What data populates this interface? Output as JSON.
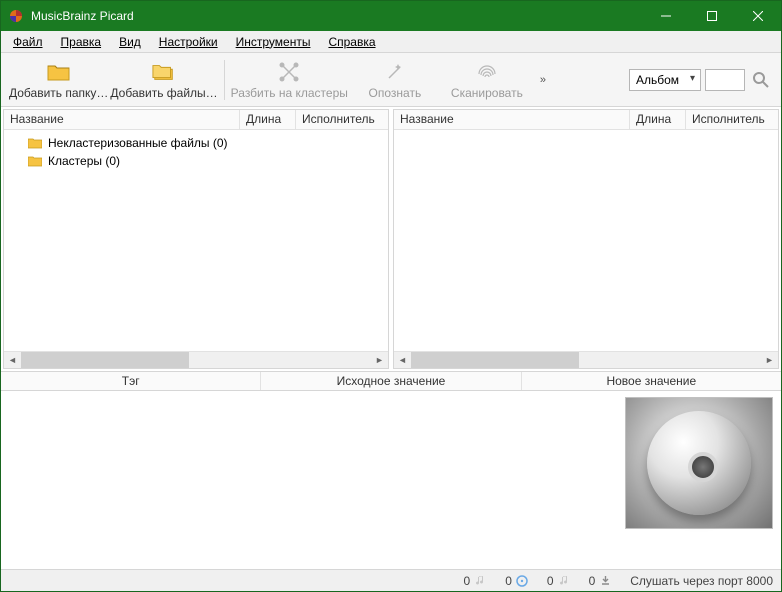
{
  "window": {
    "title": "MusicBrainz Picard"
  },
  "menu": {
    "file": "Файл",
    "edit": "Правка",
    "view": "Вид",
    "settings": "Настройки",
    "tools": "Инструменты",
    "help": "Справка"
  },
  "toolbar": {
    "add_folder": "Добавить папку…",
    "add_files": "Добавить файлы…",
    "cluster": "Разбить на кластеры",
    "lookup": "Опознать",
    "scan": "Сканировать",
    "overflow": "»"
  },
  "search": {
    "type_selected": "Альбом",
    "query": ""
  },
  "columns": {
    "name": "Название",
    "duration": "Длина",
    "artist": "Исполнитель"
  },
  "left_tree": {
    "unclustered": "Некластеризованные файлы (0)",
    "clusters": "Кластеры (0)"
  },
  "tag_headers": {
    "tag": "Тэг",
    "original": "Исходное значение",
    "new": "Новое значение"
  },
  "status": {
    "count1": "0",
    "count2": "0",
    "count3": "0",
    "count4": "0",
    "listen": "Слушать через порт 8000"
  }
}
